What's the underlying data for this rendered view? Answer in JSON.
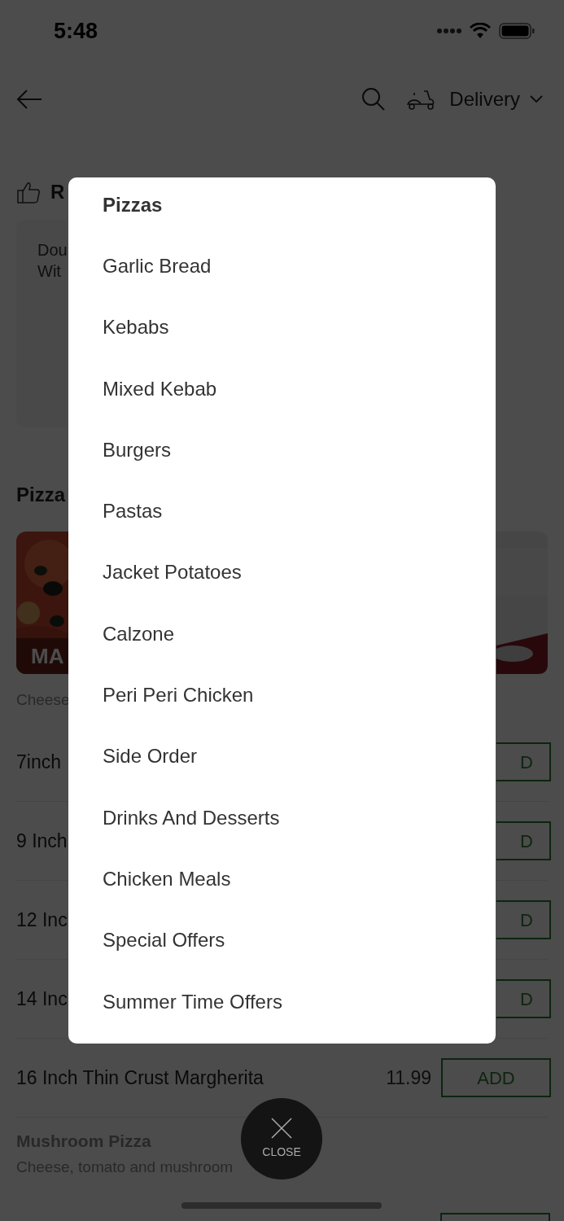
{
  "status_bar": {
    "time": "5:48"
  },
  "header": {
    "delivery_mode": "Delivery"
  },
  "recommended": {
    "heading": "R",
    "card_lines": [
      "Dou",
      "Wit"
    ]
  },
  "section": {
    "heading": "Pizza",
    "image_caption": "MA",
    "description": "Cheese"
  },
  "menu_rows": [
    {
      "kind": "partial",
      "name": "7inch",
      "button": "D"
    },
    {
      "kind": "partial",
      "name": "9 Inch",
      "button": "D"
    },
    {
      "kind": "partial",
      "name": "12 Inc",
      "button": "D"
    },
    {
      "kind": "partial",
      "name": "14 Inc",
      "button": "D"
    },
    {
      "kind": "full",
      "name": "16 Inch Thin Crust Margherita",
      "price": "11.99",
      "button": "ADD"
    }
  ],
  "next_item": {
    "name": "Mushroom Pizza",
    "description": "Cheese, tomato and mushroom"
  },
  "category_menu": {
    "items": [
      {
        "label": "Pizzas",
        "selected": true
      },
      {
        "label": "Garlic Bread",
        "selected": false
      },
      {
        "label": "Kebabs",
        "selected": false
      },
      {
        "label": "Mixed Kebab",
        "selected": false
      },
      {
        "label": "Burgers",
        "selected": false
      },
      {
        "label": "Pastas",
        "selected": false
      },
      {
        "label": "Jacket Potatoes",
        "selected": false
      },
      {
        "label": "Calzone",
        "selected": false
      },
      {
        "label": "Peri Peri Chicken",
        "selected": false
      },
      {
        "label": "Side Order",
        "selected": false
      },
      {
        "label": "Drinks And Desserts",
        "selected": false
      },
      {
        "label": "Chicken Meals",
        "selected": false
      },
      {
        "label": "Special Offers",
        "selected": false
      },
      {
        "label": "Summer Time Offers",
        "selected": false
      }
    ]
  },
  "close_button": {
    "label": "CLOSE"
  }
}
